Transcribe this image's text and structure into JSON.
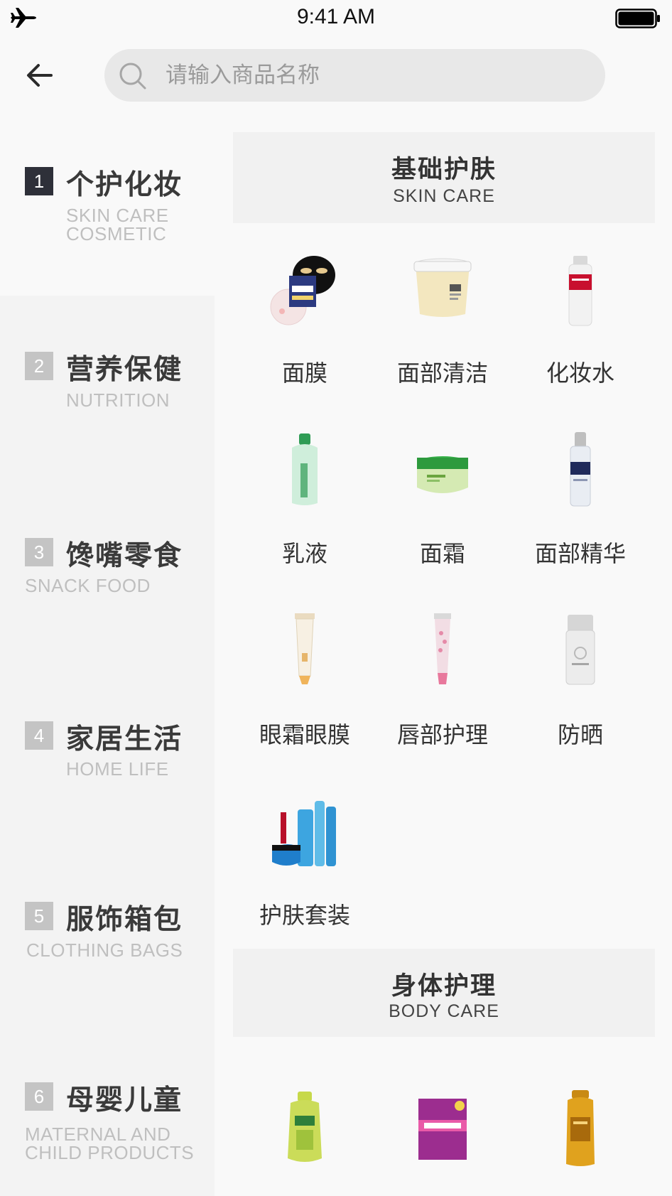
{
  "status_bar": {
    "time": "9:41 AM"
  },
  "header": {
    "search_placeholder": "请输入商品名称"
  },
  "sidebar": {
    "items": [
      {
        "num": "1",
        "title": "个护化妆",
        "sub": "SKIN CARE\nCOSMETIC",
        "active": true
      },
      {
        "num": "2",
        "title": "营养保健",
        "sub": "NUTRITION",
        "active": false
      },
      {
        "num": "3",
        "title": "馋嘴零食",
        "sub": "SNACK FOOD",
        "active": false
      },
      {
        "num": "4",
        "title": "家居生活",
        "sub": "HOME LIFE",
        "active": false
      },
      {
        "num": "5",
        "title": "服饰箱包",
        "sub": "CLOTHING BAGS",
        "active": false
      },
      {
        "num": "6",
        "title": "母婴儿童",
        "sub": "MATERNAL AND\nCHILD PRODUCTS",
        "active": false
      }
    ]
  },
  "sections": [
    {
      "title": "基础护肤",
      "sub": "SKIN CARE",
      "products": [
        {
          "label": "面膜",
          "icon": "face-mask-image"
        },
        {
          "label": "面部清洁",
          "icon": "cleanser-jar-image"
        },
        {
          "label": "化妆水",
          "icon": "toner-bottle-image"
        },
        {
          "label": "乳液",
          "icon": "lotion-bottle-image"
        },
        {
          "label": "面霜",
          "icon": "cream-jar-image"
        },
        {
          "label": "面部精华",
          "icon": "serum-bottle-image"
        },
        {
          "label": "眼霜眼膜",
          "icon": "eye-cream-tube-image"
        },
        {
          "label": "唇部护理",
          "icon": "lip-balm-tube-image"
        },
        {
          "label": "防晒",
          "icon": "sunscreen-bottle-image"
        },
        {
          "label": "护肤套装",
          "icon": "skincare-set-image"
        }
      ]
    },
    {
      "title": "身体护理",
      "sub": "BODY CARE",
      "products": [
        {
          "label": "",
          "icon": "mouthwash-bottle-image"
        },
        {
          "label": "",
          "icon": "tampon-box-image"
        },
        {
          "label": "",
          "icon": "shampoo-bottle-image"
        }
      ]
    }
  ]
}
